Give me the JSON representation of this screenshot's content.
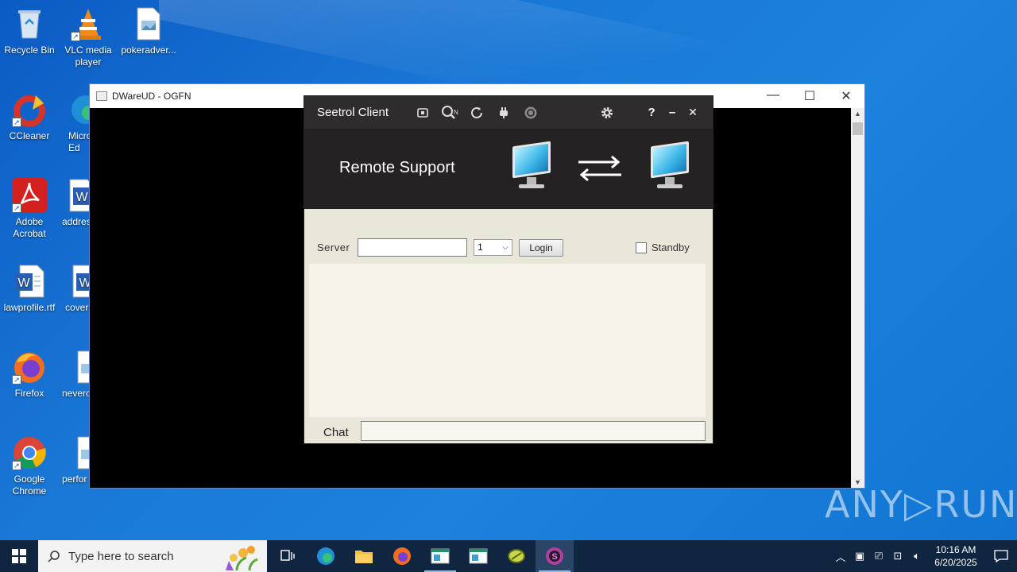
{
  "desktop": {
    "icons": [
      {
        "label": "Recycle Bin"
      },
      {
        "label": "VLC media player"
      },
      {
        "label": "pokeradver..."
      },
      {
        "label": "CCleaner"
      },
      {
        "label": "Micro Ed"
      },
      {
        "label": "Adobe Acrobat"
      },
      {
        "label": "addres"
      },
      {
        "label": "lawprofile.rtf"
      },
      {
        "label": "cover"
      },
      {
        "label": "Firefox"
      },
      {
        "label": "neverc"
      },
      {
        "label": "Google Chrome"
      },
      {
        "label": "perfor"
      }
    ]
  },
  "dware_window": {
    "title": "DWareUD - OGFN",
    "minimize": "—",
    "maximize": "☐",
    "close": "✕"
  },
  "seetrol": {
    "title": "Seetrol Client",
    "toolbar_icons": [
      "screen-icon",
      "search-id-icon",
      "refresh-icon",
      "plug-icon",
      "record-icon",
      "gear-icon",
      "help-icon",
      "minimize-icon",
      "close-icon"
    ],
    "help": "?",
    "minimize": "–",
    "close": "✕",
    "banner_title": "Remote Support",
    "server_label": "Server",
    "server_value": "",
    "select_value": "1",
    "login_label": "Login",
    "standby_label": "Standby",
    "standby_checked": false,
    "chat_label": "Chat",
    "chat_value": ""
  },
  "watermark": "ANY▷RUN",
  "taskbar": {
    "search_placeholder": "Type here to search",
    "time": "10:16 AM",
    "date": "6/20/2025"
  }
}
